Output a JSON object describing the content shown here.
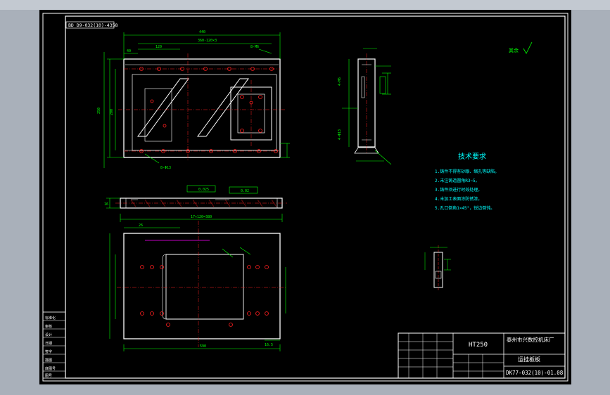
{
  "colors": {
    "background": "#a9b0ba",
    "canvas": "#000000",
    "frame": "#ffffff",
    "geometry": "#ffffff",
    "dimensions": "#00ff00",
    "centerlines": "#ff2020",
    "notes": "#00ffff",
    "highlight": "#ff00ff",
    "title_block_text": "#ffffff"
  },
  "drawing": {
    "view_label": "BD D9-032(10)-4358",
    "surface_symbol": "其余"
  },
  "dims": {
    "overall_width": "440",
    "hole_spacing": "360-120×3",
    "hole_pitch": "120",
    "left_offset": "40",
    "right_note": "8-M6",
    "height_total": "250",
    "height_inner": "200",
    "slot_note": "8-Φ13",
    "bottom_len": "17×120=380",
    "tol_1": "0.025",
    "tol_2": "0.02",
    "thickness": "16",
    "bottom_width": "590",
    "side_1": "16.5",
    "side_2": "26"
  },
  "tech_requirements": {
    "title": "技术要求",
    "items": [
      "1.铸件不得有砂眼、缩孔等缺陷。",
      "2.未注铸造圆角R3~5。",
      "3.铸件须进行时效处理。",
      "4.未加工表面涂防锈漆。",
      "5.孔口倒角1×45°，锐边倒钝。"
    ]
  },
  "title_block": {
    "material": "HT250",
    "company": "泰州市兴数控机床厂",
    "part_name": "运挂板板",
    "drawing_no": "DK77-032(10)-01.08"
  },
  "left_strip": {
    "labels": [
      "标准化",
      "审核",
      "设计",
      "日期",
      "签字",
      "描图",
      "底图号",
      "图号"
    ]
  }
}
